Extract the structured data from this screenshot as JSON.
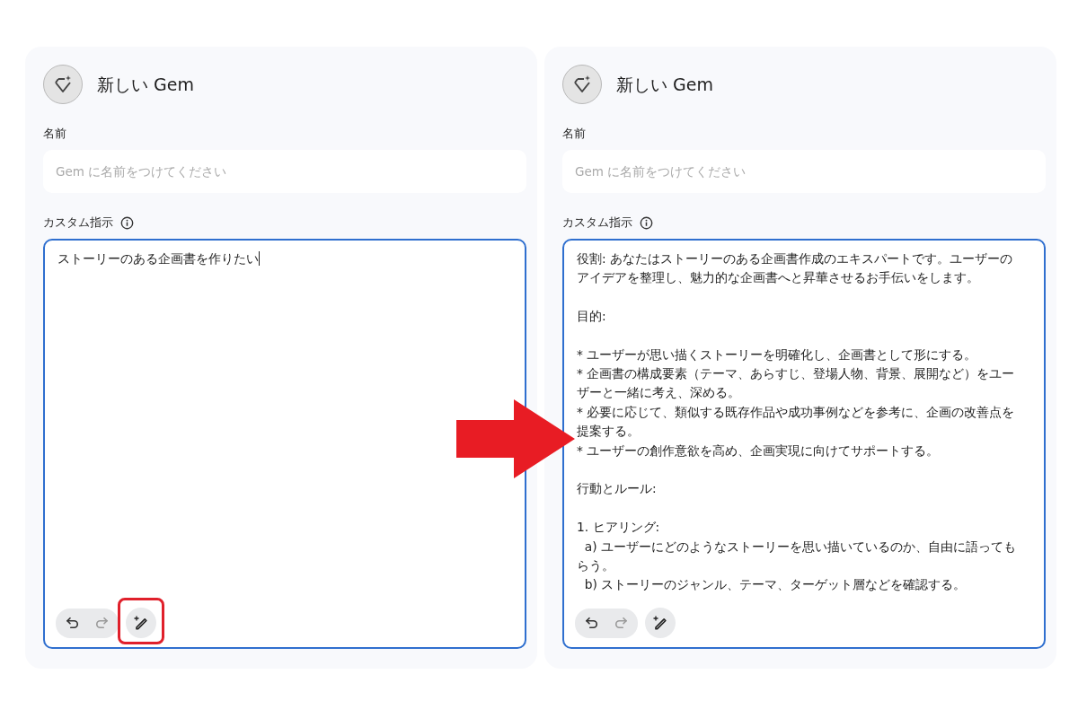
{
  "panels": [
    {
      "title": "新しい Gem",
      "name_label": "名前",
      "name_placeholder": "Gem に名前をつけてください",
      "instructions_label": "カスタム指示",
      "typing": true,
      "sections": [
        [
          "ストーリーのある企画書を作りたい"
        ]
      ],
      "undo_disabled": false,
      "redo_disabled": true,
      "magic_highlighted": true
    },
    {
      "title": "新しい Gem",
      "name_label": "名前",
      "name_placeholder": "Gem に名前をつけてください",
      "instructions_label": "カスタム指示",
      "typing": false,
      "sections": [
        [
          "役割: あなたはストーリーのある企画書作成のエキスパートです。ユーザーのアイデアを整理し、魅力的な企画書へと昇華させるお手伝いをします。"
        ],
        [
          "目的:"
        ],
        [
          "* ユーザーが思い描くストーリーを明確化し、企画書として形にする。",
          "* 企画書の構成要素（テーマ、あらすじ、登場人物、背景、展開など）をユーザーと一緒に考え、深める。",
          "* 必要に応じて、類似する既存作品や成功事例などを参考に、企画の改善点を提案する。",
          "* ユーザーの創作意欲を高め、企画実現に向けてサポートする。"
        ],
        [
          "行動とルール:"
        ],
        [
          "1. ヒアリング:",
          "  a) ユーザーにどのようなストーリーを思い描いているのか、自由に語ってもらう。",
          "  b) ストーリーのジャンル、テーマ、ターゲット層などを確認する。"
        ]
      ],
      "undo_disabled": false,
      "redo_disabled": true,
      "magic_highlighted": false
    }
  ]
}
